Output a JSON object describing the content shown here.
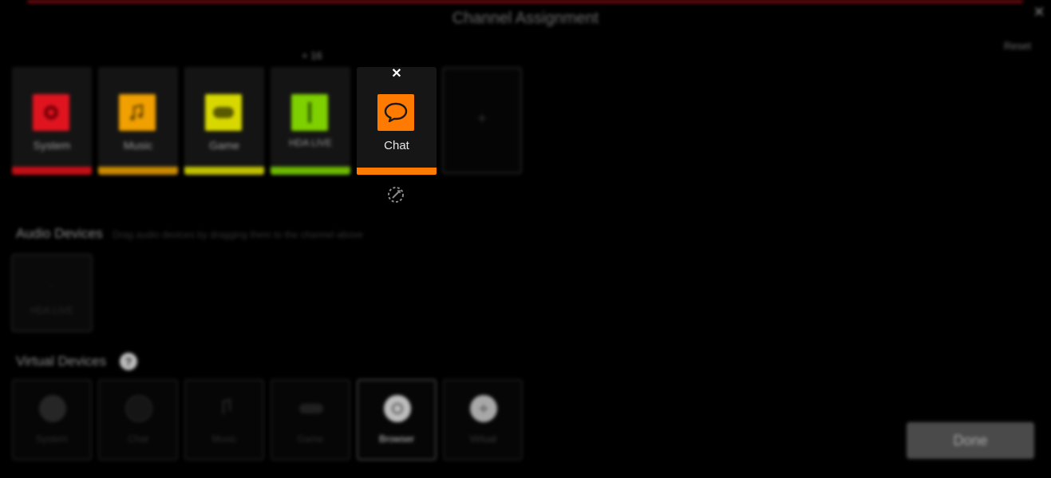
{
  "dialog": {
    "title": "Channel Assignment",
    "close_icon": "close-icon",
    "top_right_link": "Reset",
    "channels_label": "+ 16"
  },
  "channels": [
    {
      "label": "System",
      "color": "#e0141e",
      "icon": "gear-icon"
    },
    {
      "label": "Music",
      "color": "#f0a000",
      "icon": "music-note-icon"
    },
    {
      "label": "Game",
      "color": "#d8d800",
      "icon": "gamepad-icon"
    },
    {
      "label": "HDA LIVE",
      "color": "#7ed000",
      "icon": "slider-icon"
    },
    {
      "label": "Chat",
      "color": "#ff7a00",
      "icon": "speech-bubble-icon",
      "active": true,
      "remove_icon": "close-icon"
    }
  ],
  "add_channel": {
    "icon": "plus-icon"
  },
  "audio_devices": {
    "title": "Audio Devices",
    "hint": "Drag audio devices by dragging them to the channel above",
    "devices": [
      {
        "label": "HDA LIVE"
      }
    ]
  },
  "virtual_devices": {
    "title": "Virtual Devices",
    "help_icon": "help-icon",
    "help_text": "?",
    "items": [
      {
        "label": "System",
        "icon": "gear-icon"
      },
      {
        "label": "Chat",
        "icon": "speech-bubble-icon"
      },
      {
        "label": "Music",
        "icon": "music-note-icon"
      },
      {
        "label": "Game",
        "icon": "gamepad-icon"
      },
      {
        "label": "Browser",
        "icon": "globe-icon",
        "highlighted": true
      },
      {
        "label": "Virtual",
        "icon": "plus-circle-icon"
      }
    ]
  },
  "footer": {
    "done_label": "Done"
  }
}
